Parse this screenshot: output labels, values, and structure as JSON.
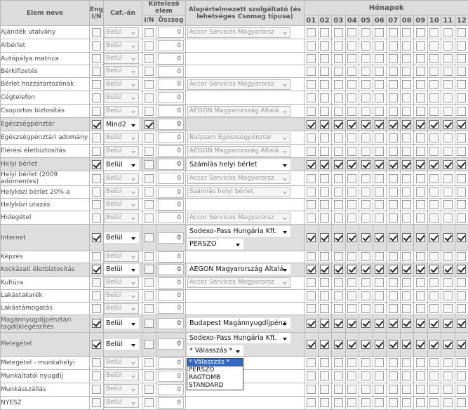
{
  "header": {
    "col_name": "Elem neve",
    "col_eng": "Eng. I/N",
    "col_caf": "Caf.-án",
    "col_mandatory": "Kötelező elem",
    "col_mand_in": "I/N",
    "col_mand_sum": "Összeg",
    "col_provider": "Alapértelmezett szolgáltató (és lehetséges Csomag típusa)",
    "col_months": "Hónapok",
    "months": [
      "01",
      "02",
      "03",
      "04",
      "05",
      "06",
      "07",
      "08",
      "09",
      "10",
      "11",
      "12"
    ]
  },
  "rows": [
    {
      "name": "Ajándék utalvány",
      "eng": false,
      "caf": "Belül",
      "mand": false,
      "sum": "0",
      "provider": "Accor Services Magyarorsz",
      "months": false
    },
    {
      "name": "Albérlet",
      "eng": false,
      "caf": "Belül",
      "mand": false,
      "sum": "0",
      "provider": "",
      "months": false
    },
    {
      "name": "Autópálya matrica",
      "eng": false,
      "caf": "Belül",
      "mand": false,
      "sum": "0",
      "provider": "",
      "months": false
    },
    {
      "name": "Bérkifizetés",
      "eng": false,
      "caf": "Belül",
      "mand": false,
      "sum": "0",
      "provider": "",
      "months": false
    },
    {
      "name": "Bérlet hozzátartozónak",
      "eng": false,
      "caf": "Belül",
      "mand": false,
      "sum": "0",
      "provider": "Accor Services Magyarorsz",
      "months": false
    },
    {
      "name": "Cégtelefon",
      "eng": false,
      "caf": "Belül",
      "mand": false,
      "sum": "0",
      "provider": "",
      "months": false
    },
    {
      "name": "Csoportos biztosítás",
      "eng": false,
      "caf": "Belül",
      "mand": false,
      "sum": "0",
      "provider": "AEGON Magyarország Általá",
      "months": false
    },
    {
      "name": "Egészségpénztár",
      "eng": true,
      "caf": "Mind2",
      "mand": true,
      "sum": "0",
      "provider": "",
      "months": true
    },
    {
      "name": "Egészségpénztári adomány",
      "eng": false,
      "caf": "Belül",
      "mand": false,
      "sum": "0",
      "provider": "Balzsam Egészségpénztár",
      "months": false
    },
    {
      "name": "Elérési életbiztosítás",
      "eng": false,
      "caf": "Belül",
      "mand": false,
      "sum": "0",
      "provider": "AEGON Magyarország Általá",
      "months": false
    },
    {
      "name": "Helyi bérlet",
      "eng": true,
      "caf": "Belül",
      "mand": false,
      "sum": "0",
      "provider": "Számlás helyi bérlet",
      "months": true
    },
    {
      "name": "Helyi bérlet (2009 adómentes)",
      "eng": false,
      "caf": "Belül",
      "mand": false,
      "sum": "0",
      "provider": "Accor Services Magyarorsz",
      "months": false
    },
    {
      "name": "Helyközi bérlet 20%-a",
      "eng": false,
      "caf": "Belül",
      "mand": false,
      "sum": "0",
      "provider": "Számlás helyi bérlet",
      "months": false
    },
    {
      "name": "Helyközi utazás",
      "eng": false,
      "caf": "Belül",
      "mand": false,
      "sum": "0",
      "provider": "",
      "months": false
    },
    {
      "name": "Hidegétel",
      "eng": false,
      "caf": "Belül",
      "mand": false,
      "sum": "0",
      "provider": "Accor Services Magyarorsz",
      "months": false
    },
    {
      "name": "Internet",
      "eng": true,
      "caf": "Belül",
      "mand": false,
      "sum": "0",
      "provider": "Sodexo-Pass Hungária Kft.",
      "package": "PERSZO",
      "months": true
    },
    {
      "name": "Képzés",
      "eng": false,
      "caf": "Belül",
      "mand": false,
      "sum": "0",
      "provider": "",
      "months": false
    },
    {
      "name": "Kockázati életbiztosítás",
      "eng": true,
      "caf": "Belül",
      "mand": false,
      "sum": "0",
      "provider": "AEGON Magyarország Általá",
      "months": true
    },
    {
      "name": "Kultúra",
      "eng": false,
      "caf": "Belül",
      "mand": false,
      "sum": "0",
      "provider": "Accor Services Magyarorsz",
      "months": false
    },
    {
      "name": "Lakástakarék",
      "eng": false,
      "caf": "Belül",
      "mand": false,
      "sum": "0",
      "provider": "",
      "months": false
    },
    {
      "name": "Lakástámogatás",
      "eng": false,
      "caf": "Belül",
      "mand": false,
      "sum": "0",
      "provider": "",
      "months": false
    },
    {
      "name": "Magánnyugdíjpénztári tagdíjkiegészítés",
      "eng": true,
      "caf": "Belül",
      "mand": false,
      "sum": "0",
      "provider": "Budapest Magánnyugdíjpénz",
      "months": true
    },
    {
      "name": "Melegétel",
      "eng": true,
      "caf": "Belül",
      "mand": false,
      "sum": "0",
      "provider": "Sodexo-Pass Hungária Kft.",
      "package": "* Válasszás *",
      "months": true
    },
    {
      "name": "Melegétel - munkahelyi",
      "eng": false,
      "caf": "Belül",
      "mand": false,
      "sum": "0",
      "provider": "",
      "months": false
    },
    {
      "name": "Munkáltatói nyugdíj",
      "eng": false,
      "caf": "Belül",
      "mand": false,
      "sum": "0",
      "provider": "",
      "months": false
    },
    {
      "name": "Munkásszállás",
      "eng": false,
      "caf": "Belül",
      "mand": false,
      "sum": "0",
      "provider": "",
      "months": false
    },
    {
      "name": "NYESZ",
      "eng": false,
      "caf": "Belül",
      "mand": false,
      "sum": "0",
      "provider": "",
      "months": false
    }
  ],
  "dropdown": {
    "options": [
      "* Válasszás *",
      "PERSZO",
      "RAGTOMB",
      "STANDARD"
    ],
    "highlighted": 0
  }
}
